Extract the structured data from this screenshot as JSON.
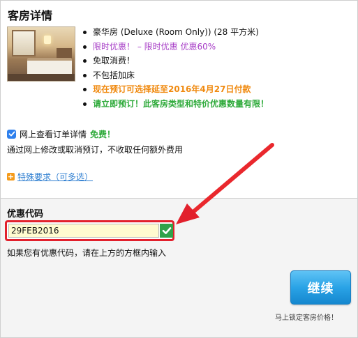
{
  "section": {
    "title": "客房详情"
  },
  "room_features": [
    {
      "text": "豪华房 (Deluxe (Room Only)) (28 平方米)",
      "style": "plain"
    },
    {
      "text": "限时优惠！ – 限时优惠 优惠60%",
      "style": "purple"
    },
    {
      "text": "免取消费！",
      "style": "plain"
    },
    {
      "text": "不包括加床",
      "style": "plain"
    },
    {
      "text": "现在预订可选择延至2016年4月27日付款",
      "style": "orange"
    },
    {
      "text": "请立即预订！此客房类型和特价优惠数量有限！",
      "style": "green"
    }
  ],
  "online_booking": {
    "checked": true,
    "label": "网上查看订单详情",
    "free_label": "免费！",
    "note": "通过网上修改或取消预订，不收取任何额外费用"
  },
  "special_request": {
    "link": "特殊要求（可多选）"
  },
  "promo": {
    "title": "优惠代码",
    "value": "29FEB2016",
    "hint": "如果您有优惠代码，请在上方的方框内输入"
  },
  "actions": {
    "continue_label": "继续",
    "lock_note": "马上锁定客房价格！"
  },
  "colors": {
    "purple": "#a63cc6",
    "orange": "#f08a10",
    "green": "#2eaa3a",
    "link_blue": "#2f7fd1",
    "button_blue": "#2aa3e6",
    "highlight_red": "#e2202c"
  },
  "icons": {
    "checkbox": "checkbox-checked-icon",
    "plus": "plus-box-icon",
    "valid": "checkmark-icon",
    "annotation": "arrow-annotation"
  }
}
